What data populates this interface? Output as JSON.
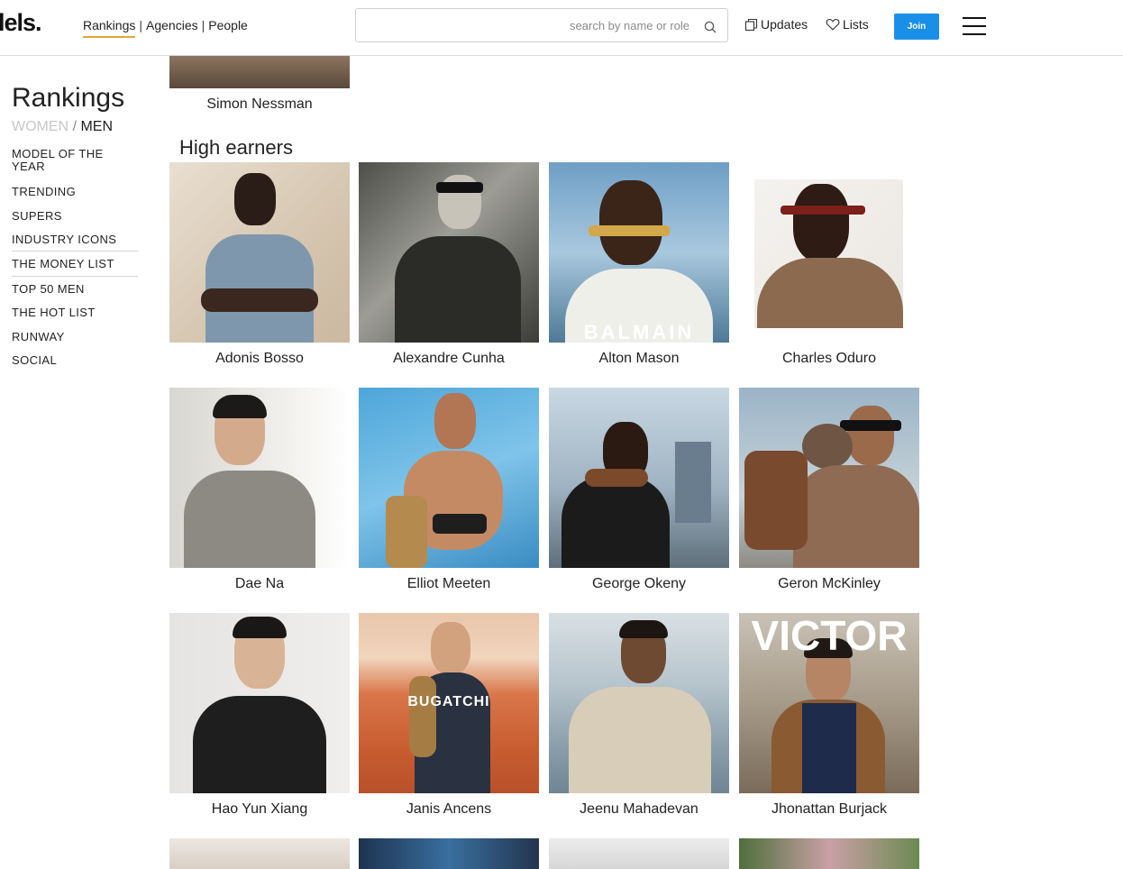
{
  "header": {
    "logo": "lels.",
    "nav": [
      "Rankings",
      "Agencies",
      "People"
    ],
    "nav_separator": "|",
    "search_placeholder": "search by name or role",
    "updates_label": "Updates",
    "lists_label": "Lists",
    "join_label": "Join",
    "accent_color": "#e5a23a",
    "join_color": "#1a8fe8"
  },
  "sidebar": {
    "title": "Rankings",
    "gender_women": "WOMEN",
    "gender_separator": "/",
    "gender_men": "MEN",
    "items": [
      "MODEL OF THE YEAR",
      "TRENDING",
      "SUPERS",
      "INDUSTRY ICONS",
      "THE MONEY LIST",
      "TOP 50 MEN",
      "THE HOT LIST",
      "RUNWAY",
      "SOCIAL"
    ]
  },
  "main": {
    "previous_model": "Simon Nessman",
    "section_title": "High earners",
    "models": [
      {
        "name": "Adonis Bosso",
        "brand": ""
      },
      {
        "name": "Alexandre Cunha",
        "brand": ""
      },
      {
        "name": "Alton Mason",
        "brand": "BALMAIN"
      },
      {
        "name": "Charles Oduro",
        "brand": ""
      },
      {
        "name": "Dae Na",
        "brand": ""
      },
      {
        "name": "Elliot Meeten",
        "brand": ""
      },
      {
        "name": "George Okeny",
        "brand": ""
      },
      {
        "name": "Geron McKinley",
        "brand": ""
      },
      {
        "name": "Hao Yun Xiang",
        "brand": ""
      },
      {
        "name": "Janis Ancens",
        "brand": "BUGATCHI"
      },
      {
        "name": "Jeenu Mahadevan",
        "brand": ""
      },
      {
        "name": "Jhonattan Burjack",
        "brand": "VICTOR"
      }
    ]
  }
}
